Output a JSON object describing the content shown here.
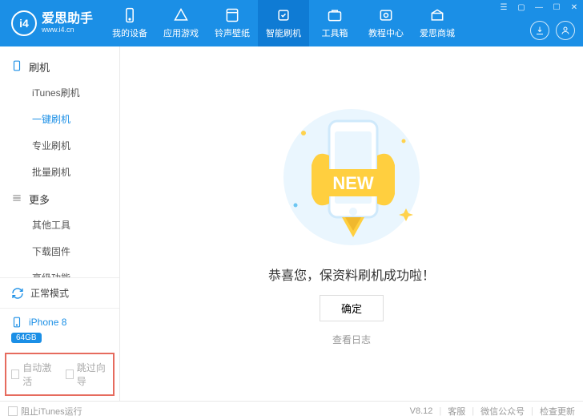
{
  "app": {
    "title": "爱思助手",
    "url": "www.i4.cn",
    "logo_text": "i4"
  },
  "topnav": [
    {
      "label": "我的设备",
      "active": false
    },
    {
      "label": "应用游戏",
      "active": false
    },
    {
      "label": "铃声壁纸",
      "active": false
    },
    {
      "label": "智能刷机",
      "active": true
    },
    {
      "label": "工具箱",
      "active": false
    },
    {
      "label": "教程中心",
      "active": false
    },
    {
      "label": "爱思商城",
      "active": false
    }
  ],
  "sidebar": {
    "groups": [
      {
        "header": "刷机",
        "icon": "phone",
        "items": [
          {
            "label": "iTunes刷机",
            "active": false
          },
          {
            "label": "一键刷机",
            "active": true
          },
          {
            "label": "专业刷机",
            "active": false
          },
          {
            "label": "批量刷机",
            "active": false
          }
        ]
      },
      {
        "header": "更多",
        "icon": "menu",
        "items": [
          {
            "label": "其他工具",
            "active": false
          },
          {
            "label": "下载固件",
            "active": false
          },
          {
            "label": "高级功能",
            "active": false
          }
        ]
      }
    ],
    "mode_label": "正常模式",
    "device_name": "iPhone 8",
    "device_badge": "64GB",
    "check_auto_activate": "自动激活",
    "check_skip_guide": "跳过向导"
  },
  "main": {
    "success_text": "恭喜您，保资料刷机成功啦！",
    "ok_label": "确定",
    "log_label": "查看日志",
    "badge_text": "NEW"
  },
  "footer": {
    "block_itunes": "阻止iTunes运行",
    "version": "V8.12",
    "support": "客服",
    "wechat": "微信公众号",
    "check_update": "检查更新"
  }
}
